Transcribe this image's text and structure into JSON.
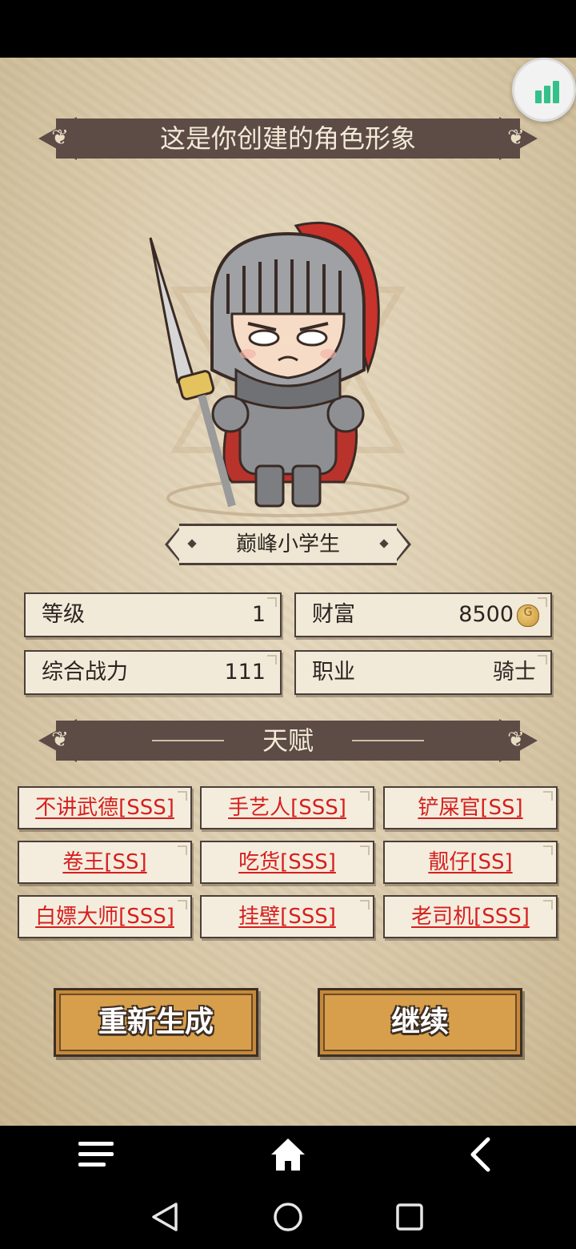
{
  "header": {
    "title": "这是你创建的角色形象"
  },
  "stats_fab": {
    "icon": "bar-chart-icon",
    "color": "#34c08a"
  },
  "character": {
    "name": "巅峰小学生"
  },
  "stats": {
    "level_label": "等级",
    "level_value": "1",
    "wealth_label": "财富",
    "wealth_value": "8500",
    "power_label": "综合战力",
    "power_value": "111",
    "job_label": "职业",
    "job_value": "骑士"
  },
  "talents": {
    "title": "天赋",
    "items": [
      "不讲武德[SSS]",
      "手艺人[SSS]",
      "铲屎官[SS]",
      "卷王[SS]",
      "吃货[SSS]",
      "靓仔[SS]",
      "白嫖大师[SSS]",
      "挂壁[SSS]",
      "老司机[SSS]"
    ]
  },
  "buttons": {
    "regenerate": "重新生成",
    "continue": "继续"
  },
  "nav": {
    "menu_icon": "menu-icon",
    "home_icon": "home-icon",
    "back_icon": "back-arrow-icon"
  },
  "colors": {
    "banner": "#5d4b46",
    "talent_text": "#d61f1f",
    "button": "#d79f4c"
  }
}
